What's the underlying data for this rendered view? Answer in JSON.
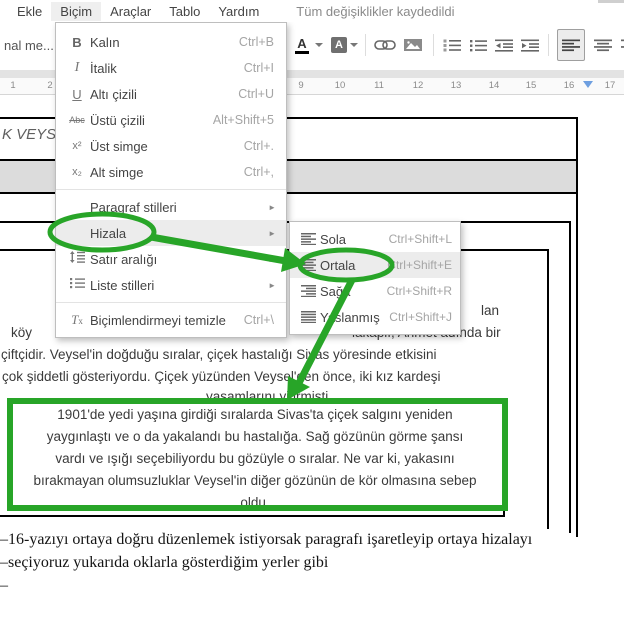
{
  "menubar": {
    "items": [
      "Ekle",
      "Biçim",
      "Araçlar",
      "Tablo",
      "Yardım"
    ],
    "active_item": "Biçim",
    "status": "Tüm değişiklikler kaydedildi"
  },
  "toolbar": {
    "style_selector_fragment": "nal me..."
  },
  "icons": {
    "bold": "B",
    "italic": "I",
    "underline": "U",
    "strikethrough": "Abc",
    "superscript": "x²",
    "subscript": "x₂",
    "clear_format_t": "T",
    "clear_format_x": "x",
    "submenu_arrow": "►",
    "text_color_letter": "A",
    "highlight_letter": "A"
  },
  "format_menu": {
    "items": [
      {
        "label": "Kalın",
        "shortcut": "Ctrl+B"
      },
      {
        "label": "İtalik",
        "shortcut": "Ctrl+I"
      },
      {
        "label": "Altı çizili",
        "shortcut": "Ctrl+U"
      },
      {
        "label": "Üstü çizili",
        "shortcut": "Alt+Shift+5"
      },
      {
        "label": "Üst simge",
        "shortcut": "Ctrl+."
      },
      {
        "label": "Alt simge",
        "shortcut": "Ctrl+,"
      },
      {
        "label": "Paragraf stilleri"
      },
      {
        "label": "Hizala"
      },
      {
        "label": "Satır aralığı"
      },
      {
        "label": "Liste stilleri"
      },
      {
        "label": "Biçimlendirmeyi temizle",
        "shortcut": "Ctrl+\\"
      }
    ]
  },
  "align_submenu": {
    "items": [
      {
        "label": "Sola",
        "shortcut": "Ctrl+Shift+L"
      },
      {
        "label": "Ortala",
        "shortcut": "Ctrl+Shift+E"
      },
      {
        "label": "Sağa",
        "shortcut": "Ctrl+Shift+R"
      },
      {
        "label": "Yaslanmış",
        "shortcut": "Ctrl+Shift+J"
      }
    ],
    "highlighted": "Ortala"
  },
  "ruler": {
    "left_numbers": [
      "1",
      "2"
    ],
    "right_numbers": [
      "9",
      "10",
      "11",
      "12",
      "13",
      "14",
      "15",
      "16",
      "17"
    ]
  },
  "document": {
    "title_fragment": "K VEYSEL",
    "fragment_lan": "lan",
    "fragment_koy": "köy",
    "fragment_lakapli": "lakaplı, Ahmet adında bir",
    "line_ciftcidir": "çiftçidir. Veysel'in doğduğu sıralar, çiçek hastalığı Sivas yöresinde etkisini",
    "line_cok": "çok şiddetli gösteriyordu. Çiçek yüzünden Veysel'den önce, iki kız kardeşi",
    "line_yasam": "yaşamlarını yitirmişti.",
    "highlighted_paragraph": [
      "1901'de yedi yaşına girdiği sıralarda Sivas'ta çiçek salgını yeniden",
      "yaygınlaştı ve o da yakalandı bu hastalığa. Sağ gözünün görme şansı",
      "vardı ve ışığı seçebiliyordu bu gözüyle o sıralar. Ne var ki, yakasını",
      "bırakmayan olumsuzluklar Veysel'in diğer gözünün de kör olmasına sebep",
      "oldu."
    ]
  },
  "notes": {
    "line1": "–16-yazıyı ortaya doğru düzenlemek istiyorsak paragrafı işaretleyip ortaya hizalayı",
    "line2": "–seçiyoruz yukarıda oklarla gösterdiğim yerler gibi",
    "line3": "–"
  },
  "colors": {
    "annotation_green": "#28a528",
    "ruler_marker_blue": "#6e9fe0",
    "table_row_gray": "#dcdcdc"
  }
}
